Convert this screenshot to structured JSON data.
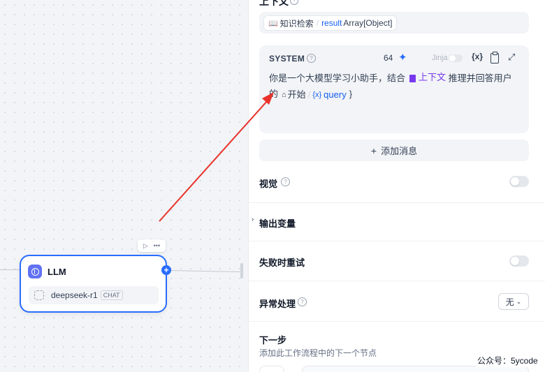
{
  "canvas": {
    "llm_node": {
      "title": "LLM",
      "model_name": "deepseek-r1",
      "model_tag": "CHAT",
      "toolbar": {
        "run_glyph": "▷",
        "more_glyph": "•••"
      },
      "add_glyph": "+"
    }
  },
  "panel": {
    "context_section": {
      "title": "上下文",
      "help_glyph": "?",
      "variable": {
        "node": "知识检索",
        "separator": "/",
        "name": "result",
        "type": "Array[Object]"
      }
    },
    "system_prompt": {
      "role_label": "SYSTEM",
      "help_glyph": "?",
      "token_count": "64",
      "jinja_label": "Jinja",
      "jinja_enabled": false,
      "insert_var_glyph": "{x}",
      "prompt_before": "你是一个大模型学习小助手，结合",
      "context_var": "上下文",
      "prompt_middle": "推理并回答用户的",
      "ref_node": "开始",
      "ref_separator": "/",
      "ref_var_glyph": "{x}",
      "ref_var": "query",
      "ref_close": "}"
    },
    "add_message": {
      "plus": "+",
      "label": "添加消息"
    },
    "vision": {
      "label": "视觉",
      "help_glyph": "?",
      "enabled": false
    },
    "output_vars": {
      "label": "输出变量",
      "chevron": "›"
    },
    "retry": {
      "label": "失败时重试",
      "enabled": false
    },
    "error_handling": {
      "label": "异常处理",
      "help_glyph": "?",
      "value": "无",
      "chevron": "⌄"
    },
    "next_step": {
      "title": "下一步",
      "description": "添加此工作流程中的下一个节点"
    }
  },
  "watermark": "公众号：5ycode",
  "icons": [
    "book-icon",
    "sparkle-icon",
    "clipboard-icon",
    "expand-icon",
    "document-icon",
    "home-icon",
    "variable-icon",
    "llm-icon",
    "model-icon",
    "play-icon",
    "more-icon",
    "plus-icon",
    "chevron-right-icon",
    "chevron-down-icon",
    "help-circle-icon"
  ],
  "colors": {
    "accent": "#296dff",
    "context_purple": "#7839ee",
    "variable_blue": "#155eef",
    "annotation_arrow": "#e8322b"
  }
}
